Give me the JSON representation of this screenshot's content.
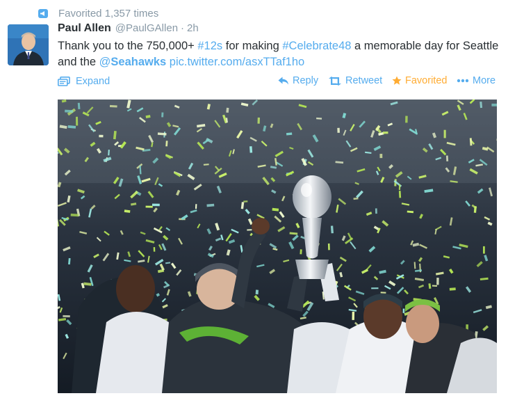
{
  "context": {
    "text": "Favorited 1,357 times",
    "icon": "favorited-badge-icon"
  },
  "author": {
    "name": "Paul Allen",
    "handle": "@PaulGAllen",
    "separator": "·",
    "time": "2h"
  },
  "tweet": {
    "t1": "Thank you to the 750,000+ ",
    "hashtag1": "#12s",
    "t2": " for making ",
    "hashtag2": "#Celebrate48",
    "t3": " a memorable day for Seattle and the ",
    "mention_at": "@",
    "mention_name": "Seahawks",
    "t4": " ",
    "pic_link": "pic.twitter.com/asxTTaf1ho"
  },
  "actions": {
    "expand": "Expand",
    "reply": "Reply",
    "retweet": "Retweet",
    "favorited": "Favorited",
    "more": "More"
  },
  "colors": {
    "link": "#55acee",
    "favorited": "#ffac33",
    "meta": "#8899a6",
    "text": "#292f33"
  }
}
